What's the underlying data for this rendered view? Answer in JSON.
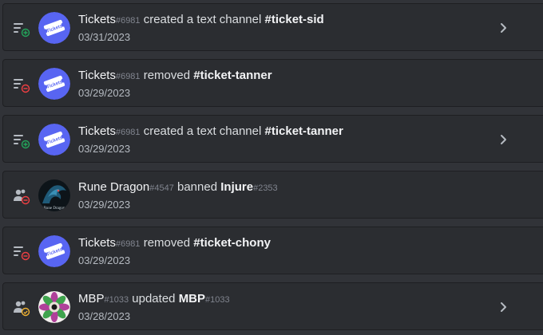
{
  "entries": [
    {
      "action_icon": "channel-create-icon",
      "avatar": "tickets-bot-avatar",
      "user": "Tickets",
      "user_disc": "#6981",
      "action": "created a text channel",
      "target": "#ticket-sid",
      "target_disc": "",
      "date": "03/31/2023",
      "expandable": true
    },
    {
      "action_icon": "channel-delete-icon",
      "avatar": "tickets-bot-avatar",
      "user": "Tickets",
      "user_disc": "#6981",
      "action": "removed",
      "target": "#ticket-tanner",
      "target_disc": "",
      "date": "03/29/2023",
      "expandable": false
    },
    {
      "action_icon": "channel-create-icon",
      "avatar": "tickets-bot-avatar",
      "user": "Tickets",
      "user_disc": "#6981",
      "action": "created a text channel",
      "target": "#ticket-tanner",
      "target_disc": "",
      "date": "03/29/2023",
      "expandable": true
    },
    {
      "action_icon": "member-ban-icon",
      "avatar": "rune-dragon-avatar",
      "user": "Rune Dragon",
      "user_disc": "#4547",
      "action": "banned",
      "target": "Injure",
      "target_disc": "#2353",
      "date": "03/29/2023",
      "expandable": false
    },
    {
      "action_icon": "channel-delete-icon",
      "avatar": "tickets-bot-avatar",
      "user": "Tickets",
      "user_disc": "#6981",
      "action": "removed",
      "target": "#ticket-chony",
      "target_disc": "",
      "date": "03/29/2023",
      "expandable": false
    },
    {
      "action_icon": "member-update-icon",
      "avatar": "mbp-avatar",
      "user": "MBP",
      "user_disc": "#1033",
      "action": "updated",
      "target": "MBP",
      "target_disc": "#1033",
      "date": "03/28/2023",
      "expandable": true
    }
  ],
  "avatar_text": {
    "tickets": "Tickets",
    "rune": "Rune Dragon"
  },
  "colors": {
    "background": "#313338",
    "card": "#2b2d31",
    "create_green": "#23a55a",
    "delete_red": "#f23f43",
    "update_yellow": "#f0b232",
    "tickets_blue": "#5865f2"
  }
}
